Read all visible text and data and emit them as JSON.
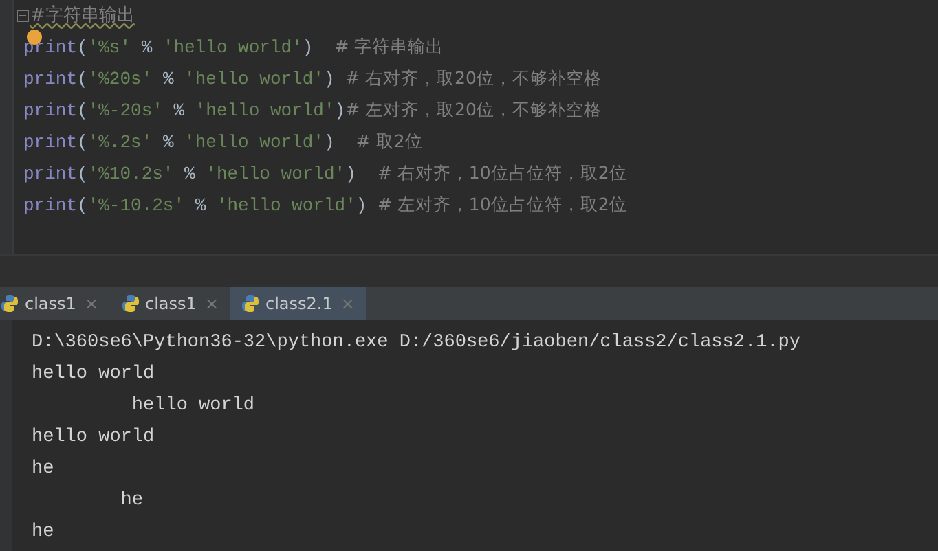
{
  "editor": {
    "header_comment": "#字符串输出",
    "lines": [
      [
        {
          "kind": "builtin",
          "text": "print"
        },
        {
          "kind": "punct",
          "text": "("
        },
        {
          "kind": "string",
          "text": "'%s'"
        },
        {
          "kind": "punct",
          "text": " % "
        },
        {
          "kind": "string",
          "text": "'hello world'"
        },
        {
          "kind": "punct",
          "text": ")  "
        },
        {
          "kind": "comment",
          "text": "# 字符串输出"
        }
      ],
      [
        {
          "kind": "builtin",
          "text": "print"
        },
        {
          "kind": "punct",
          "text": "("
        },
        {
          "kind": "string",
          "text": "'%20s'"
        },
        {
          "kind": "punct",
          "text": " % "
        },
        {
          "kind": "string",
          "text": "'hello world'"
        },
        {
          "kind": "punct",
          "text": ") "
        },
        {
          "kind": "comment",
          "text": "# 右对齐，取20位，不够补空格"
        }
      ],
      [
        {
          "kind": "builtin",
          "text": "print"
        },
        {
          "kind": "punct",
          "text": "("
        },
        {
          "kind": "string",
          "text": "'%-20s'"
        },
        {
          "kind": "punct",
          "text": " % "
        },
        {
          "kind": "string",
          "text": "'hello world'"
        },
        {
          "kind": "punct",
          "text": ")"
        },
        {
          "kind": "comment",
          "text": "# 左对齐，取20位，不够补空格"
        }
      ],
      [
        {
          "kind": "builtin",
          "text": "print"
        },
        {
          "kind": "punct",
          "text": "("
        },
        {
          "kind": "string",
          "text": "'%.2s'"
        },
        {
          "kind": "punct",
          "text": " % "
        },
        {
          "kind": "string",
          "text": "'hello world'"
        },
        {
          "kind": "punct",
          "text": ")  "
        },
        {
          "kind": "comment",
          "text": "# 取2位"
        }
      ],
      [
        {
          "kind": "builtin",
          "text": "print"
        },
        {
          "kind": "punct",
          "text": "("
        },
        {
          "kind": "string",
          "text": "'%10.2s'"
        },
        {
          "kind": "punct",
          "text": " % "
        },
        {
          "kind": "string",
          "text": "'hello world'"
        },
        {
          "kind": "punct",
          "text": ")  "
        },
        {
          "kind": "comment",
          "text": "# 右对齐，10位占位符，取2位"
        }
      ],
      [
        {
          "kind": "builtin",
          "text": "print"
        },
        {
          "kind": "punct",
          "text": "("
        },
        {
          "kind": "string",
          "text": "'%-10.2s'"
        },
        {
          "kind": "punct",
          "text": " % "
        },
        {
          "kind": "string",
          "text": "'hello world'"
        },
        {
          "kind": "punct",
          "text": ") "
        },
        {
          "kind": "comment",
          "text": "# 左对齐，10位占位符，取2位"
        }
      ]
    ]
  },
  "run_tabs": [
    {
      "label": "class1",
      "close": "×",
      "selected": false
    },
    {
      "label": "class1",
      "close": "×",
      "selected": false
    },
    {
      "label": "class2.1",
      "close": "×",
      "selected": true
    }
  ],
  "console": {
    "lines": [
      "D:\\360se6\\Python36-32\\python.exe D:/360se6/jiaoben/class2/class2.1.py",
      "hello world",
      "         hello world",
      "hello world",
      "he",
      "        he",
      "he"
    ]
  }
}
